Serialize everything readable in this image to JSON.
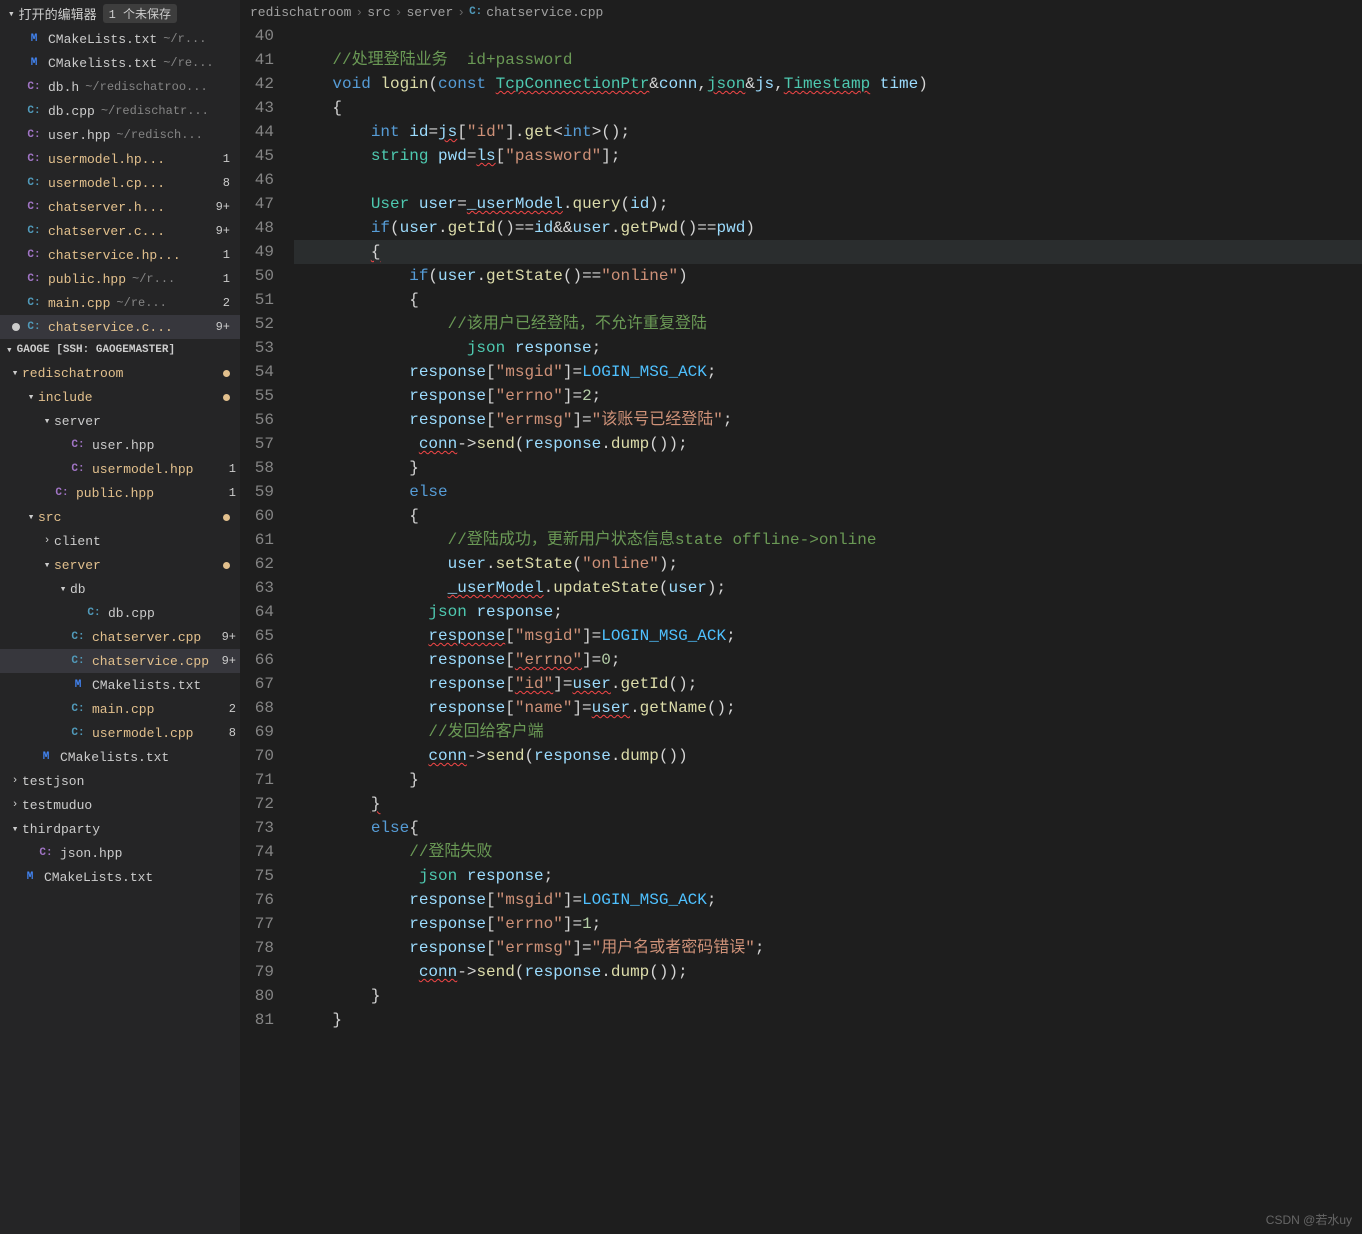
{
  "openEditors": {
    "title": "打开的编辑器",
    "unsavedBadge": "1 个未保存",
    "files": [
      {
        "icon": "M",
        "iconClass": "icon-cmake",
        "name": "CMakeLists.txt",
        "path": "~/r...",
        "modified": false,
        "badge": ""
      },
      {
        "icon": "M",
        "iconClass": "icon-cmake",
        "name": "CMakelists.txt",
        "path": "~/re...",
        "modified": false,
        "badge": ""
      },
      {
        "icon": "C:",
        "iconClass": "icon-hpp",
        "name": "db.h",
        "path": "~/redischatroo...",
        "modified": false,
        "badge": ""
      },
      {
        "icon": "C:",
        "iconClass": "icon-cpp",
        "name": "db.cpp",
        "path": "~/redischatr...",
        "modified": false,
        "badge": ""
      },
      {
        "icon": "C:",
        "iconClass": "icon-hpp",
        "name": "user.hpp",
        "path": "~/redisch...",
        "modified": false,
        "badge": ""
      },
      {
        "icon": "C:",
        "iconClass": "icon-hpp",
        "name": "usermodel.hp...",
        "path": "",
        "modified": true,
        "badge": "1"
      },
      {
        "icon": "C:",
        "iconClass": "icon-cpp",
        "name": "usermodel.cp...",
        "path": "",
        "modified": true,
        "badge": "8"
      },
      {
        "icon": "C:",
        "iconClass": "icon-hpp",
        "name": "chatserver.h...",
        "path": "",
        "modified": true,
        "badge": "9+"
      },
      {
        "icon": "C:",
        "iconClass": "icon-cpp",
        "name": "chatserver.c...",
        "path": "",
        "modified": true,
        "badge": "9+"
      },
      {
        "icon": "C:",
        "iconClass": "icon-hpp",
        "name": "chatservice.hp...",
        "path": "",
        "modified": true,
        "badge": "1"
      },
      {
        "icon": "C:",
        "iconClass": "icon-hpp",
        "name": "public.hpp",
        "path": "~/r...",
        "modified": true,
        "badge": "1"
      },
      {
        "icon": "C:",
        "iconClass": "icon-cpp",
        "name": "main.cpp",
        "path": "~/re...",
        "modified": true,
        "badge": "2"
      },
      {
        "icon": "C:",
        "iconClass": "icon-cpp",
        "name": "chatservice.c...",
        "path": "",
        "modified": true,
        "badge": "9+",
        "active": true,
        "unsaved": true
      }
    ]
  },
  "workspace": {
    "title": "GAOGE [SSH: GAOGEMASTER]",
    "tree": [
      {
        "indent": 0,
        "chev": "v",
        "label": "redischatroom",
        "modified": true,
        "gitDot": true
      },
      {
        "indent": 1,
        "chev": "v",
        "label": "include",
        "modified": true,
        "gitDot": true
      },
      {
        "indent": 2,
        "chev": "v",
        "label": "server",
        "modified": false
      },
      {
        "indent": 3,
        "chev": "",
        "icon": "C:",
        "iconClass": "icon-hpp",
        "label": "user.hpp"
      },
      {
        "indent": 3,
        "chev": "",
        "icon": "C:",
        "iconClass": "icon-hpp",
        "label": "usermodel.hpp",
        "modified": true,
        "badge": "1"
      },
      {
        "indent": 2,
        "chev": "",
        "icon": "C:",
        "iconClass": "icon-hpp",
        "label": "public.hpp",
        "modified": true,
        "badge": "1"
      },
      {
        "indent": 1,
        "chev": "v",
        "label": "src",
        "modified": true,
        "gitDot": true
      },
      {
        "indent": 2,
        "chev": ">",
        "label": "client"
      },
      {
        "indent": 2,
        "chev": "v",
        "label": "server",
        "modified": true,
        "gitDot": true
      },
      {
        "indent": 3,
        "chev": "v",
        "label": "db"
      },
      {
        "indent": 4,
        "chev": "",
        "icon": "C:",
        "iconClass": "icon-cpp",
        "label": "db.cpp"
      },
      {
        "indent": 3,
        "chev": "",
        "icon": "C:",
        "iconClass": "icon-cpp",
        "label": "chatserver.cpp",
        "modified": true,
        "badge": "9+"
      },
      {
        "indent": 3,
        "chev": "",
        "icon": "C:",
        "iconClass": "icon-cpp",
        "label": "chatservice.cpp",
        "modified": true,
        "badge": "9+",
        "selected": true
      },
      {
        "indent": 3,
        "chev": "",
        "icon": "M",
        "iconClass": "icon-cmake",
        "label": "CMakelists.txt"
      },
      {
        "indent": 3,
        "chev": "",
        "icon": "C:",
        "iconClass": "icon-cpp",
        "label": "main.cpp",
        "modified": true,
        "badge": "2"
      },
      {
        "indent": 3,
        "chev": "",
        "icon": "C:",
        "iconClass": "icon-cpp",
        "label": "usermodel.cpp",
        "modified": true,
        "badge": "8"
      },
      {
        "indent": 1,
        "chev": "",
        "icon": "M",
        "iconClass": "icon-cmake",
        "label": "CMakelists.txt"
      },
      {
        "indent": 0,
        "chev": ">",
        "label": "testjson"
      },
      {
        "indent": 0,
        "chev": ">",
        "label": "testmuduo"
      },
      {
        "indent": 0,
        "chev": "v",
        "label": "thirdparty"
      },
      {
        "indent": 1,
        "chev": "",
        "icon": "C:",
        "iconClass": "icon-hpp",
        "label": "json.hpp"
      },
      {
        "indent": 0,
        "chev": "",
        "icon": "M",
        "iconClass": "icon-cmake",
        "label": "CMakeLists.txt"
      }
    ]
  },
  "breadcrumb": [
    "redischatroom",
    "src",
    "server",
    "chatservice.cpp"
  ],
  "code": {
    "startLine": 40,
    "lines": [
      {
        "n": 40,
        "html": ""
      },
      {
        "n": 41,
        "html": "    <span class='tk-comment'>//处理登陆业务  id+password</span>"
      },
      {
        "n": 42,
        "html": "    <span class='tk-keyword'>void</span> <span class='tk-func'>login</span>(<span class='tk-keyword'>const</span> <span class='tk-type squiggle'>TcpConnectionPtr</span>&amp;<span class='tk-var'>conn</span>,<span class='tk-type squiggle'>json</span>&amp;<span class='tk-var'>js</span>,<span class='tk-type squiggle'>Timestamp</span> <span class='tk-var'>time</span>)"
      },
      {
        "n": 43,
        "html": "    {"
      },
      {
        "n": 44,
        "html": "        <span class='tk-keyword'>int</span> <span class='tk-var'>id</span>=<span class='tk-var squiggle'>js</span>[<span class='tk-str'>\"id\"</span>].<span class='tk-func'>get</span>&lt;<span class='tk-keyword'>int</span>&gt;();"
      },
      {
        "n": 45,
        "html": "        <span class='tk-type'>string</span> <span class='tk-var'>pwd</span>=<span class='tk-var squiggle'>ls</span>[<span class='tk-str'>\"password\"</span>];"
      },
      {
        "n": 46,
        "html": ""
      },
      {
        "n": 47,
        "html": "        <span class='tk-type'>User</span> <span class='tk-var'>user</span>=<span class='tk-var squiggle'>_userModel</span>.<span class='tk-func'>query</span>(<span class='tk-var'>id</span>);"
      },
      {
        "n": 48,
        "html": "        <span class='tk-keyword'>if</span>(<span class='tk-var'>user</span>.<span class='tk-func'>getId</span>()==<span class='tk-var'>id</span>&amp;&amp;<span class='tk-var'>user</span>.<span class='tk-func'>getPwd</span>()==<span class='tk-var'>pwd</span>)"
      },
      {
        "n": 49,
        "html": "        <span class='squiggle'>{</span>",
        "hl": true
      },
      {
        "n": 50,
        "html": "            <span class='tk-keyword'>if</span>(<span class='tk-var'>user</span>.<span class='tk-func'>getState</span>()==<span class='tk-str'>\"online\"</span>)"
      },
      {
        "n": 51,
        "html": "            {"
      },
      {
        "n": 52,
        "html": "                <span class='tk-comment'>//该用户已经登陆，不允许重复登陆</span>"
      },
      {
        "n": 53,
        "html": "                  <span class='tk-type'>json</span> <span class='tk-var'>response</span>;"
      },
      {
        "n": 54,
        "html": "            <span class='tk-var'>response</span>[<span class='tk-str'>\"msgid\"</span>]=<span class='tk-const'>LOGIN_MSG_ACK</span>;"
      },
      {
        "n": 55,
        "html": "            <span class='tk-var'>response</span>[<span class='tk-str'>\"errno\"</span>]=<span class='tk-num'>2</span>;"
      },
      {
        "n": 56,
        "html": "            <span class='tk-var'>response</span>[<span class='tk-str'>\"errmsg\"</span>]=<span class='tk-str'>\"该账号已经登陆\"</span>;"
      },
      {
        "n": 57,
        "html": "             <span class='tk-var squiggle'>conn</span>-&gt;<span class='tk-func'>send</span>(<span class='tk-var'>response</span>.<span class='tk-func'>dump</span>());"
      },
      {
        "n": 58,
        "html": "            }"
      },
      {
        "n": 59,
        "html": "            <span class='tk-keyword'>else</span>"
      },
      {
        "n": 60,
        "html": "            {"
      },
      {
        "n": 61,
        "html": "                <span class='tk-comment'>//登陆成功，更新用户状态信息state offline-&gt;online</span>"
      },
      {
        "n": 62,
        "html": "                <span class='tk-var'>user</span>.<span class='tk-func'>setState</span>(<span class='tk-str'>\"online\"</span>);"
      },
      {
        "n": 63,
        "html": "                <span class='tk-var squiggle'>_userModel</span>.<span class='tk-func'>updateState</span>(<span class='tk-var'>user</span>);"
      },
      {
        "n": 64,
        "html": "              <span class='tk-type'>json</span> <span class='tk-var'>response</span>;"
      },
      {
        "n": 65,
        "html": "              <span class='tk-var squiggle'>response</span>[<span class='tk-str'>\"msgid\"</span>]=<span class='tk-const'>LOGIN_MSG_ACK</span>;"
      },
      {
        "n": 66,
        "html": "              <span class='tk-var'>response</span>[<span class='tk-str squiggle'>\"errno\"</span>]=<span class='tk-num'>0</span>;"
      },
      {
        "n": 67,
        "html": "              <span class='tk-var'>response</span>[<span class='tk-str squiggle'>\"id\"</span>]=<span class='tk-var squiggle'>user</span>.<span class='tk-func'>getId</span>();"
      },
      {
        "n": 68,
        "html": "              <span class='tk-var'>response</span>[<span class='tk-str'>\"name\"</span>]=<span class='tk-var squiggle'>user</span>.<span class='tk-func'>getName</span>();"
      },
      {
        "n": 69,
        "html": "              <span class='tk-comment'>//发回给客户端</span>"
      },
      {
        "n": 70,
        "html": "              <span class='tk-var squiggle'>conn</span>-&gt;<span class='tk-func'>send</span>(<span class='tk-var'>response</span>.<span class='tk-func'>dump</span>())"
      },
      {
        "n": 71,
        "html": "            }"
      },
      {
        "n": 72,
        "html": "        <span class='squiggle'>}</span>"
      },
      {
        "n": 73,
        "html": "        <span class='tk-keyword'>else</span>{"
      },
      {
        "n": 74,
        "html": "            <span class='tk-comment'>//登陆失败</span>"
      },
      {
        "n": 75,
        "html": "             <span class='tk-type'>json</span> <span class='tk-var'>response</span>;"
      },
      {
        "n": 76,
        "html": "            <span class='tk-var'>response</span>[<span class='tk-str'>\"msgid\"</span>]=<span class='tk-const'>LOGIN_MSG_ACK</span>;"
      },
      {
        "n": 77,
        "html": "            <span class='tk-var'>response</span>[<span class='tk-str'>\"errno\"</span>]=<span class='tk-num'>1</span>;"
      },
      {
        "n": 78,
        "html": "            <span class='tk-var'>response</span>[<span class='tk-str'>\"errmsg\"</span>]=<span class='tk-str'>\"用户名或者密码错误\"</span>;"
      },
      {
        "n": 79,
        "html": "             <span class='tk-var squiggle'>conn</span>-&gt;<span class='tk-func'>send</span>(<span class='tk-var'>response</span>.<span class='tk-func'>dump</span>());"
      },
      {
        "n": 80,
        "html": "        }"
      },
      {
        "n": 81,
        "html": "    }"
      }
    ]
  },
  "watermark": "CSDN @若水uy"
}
